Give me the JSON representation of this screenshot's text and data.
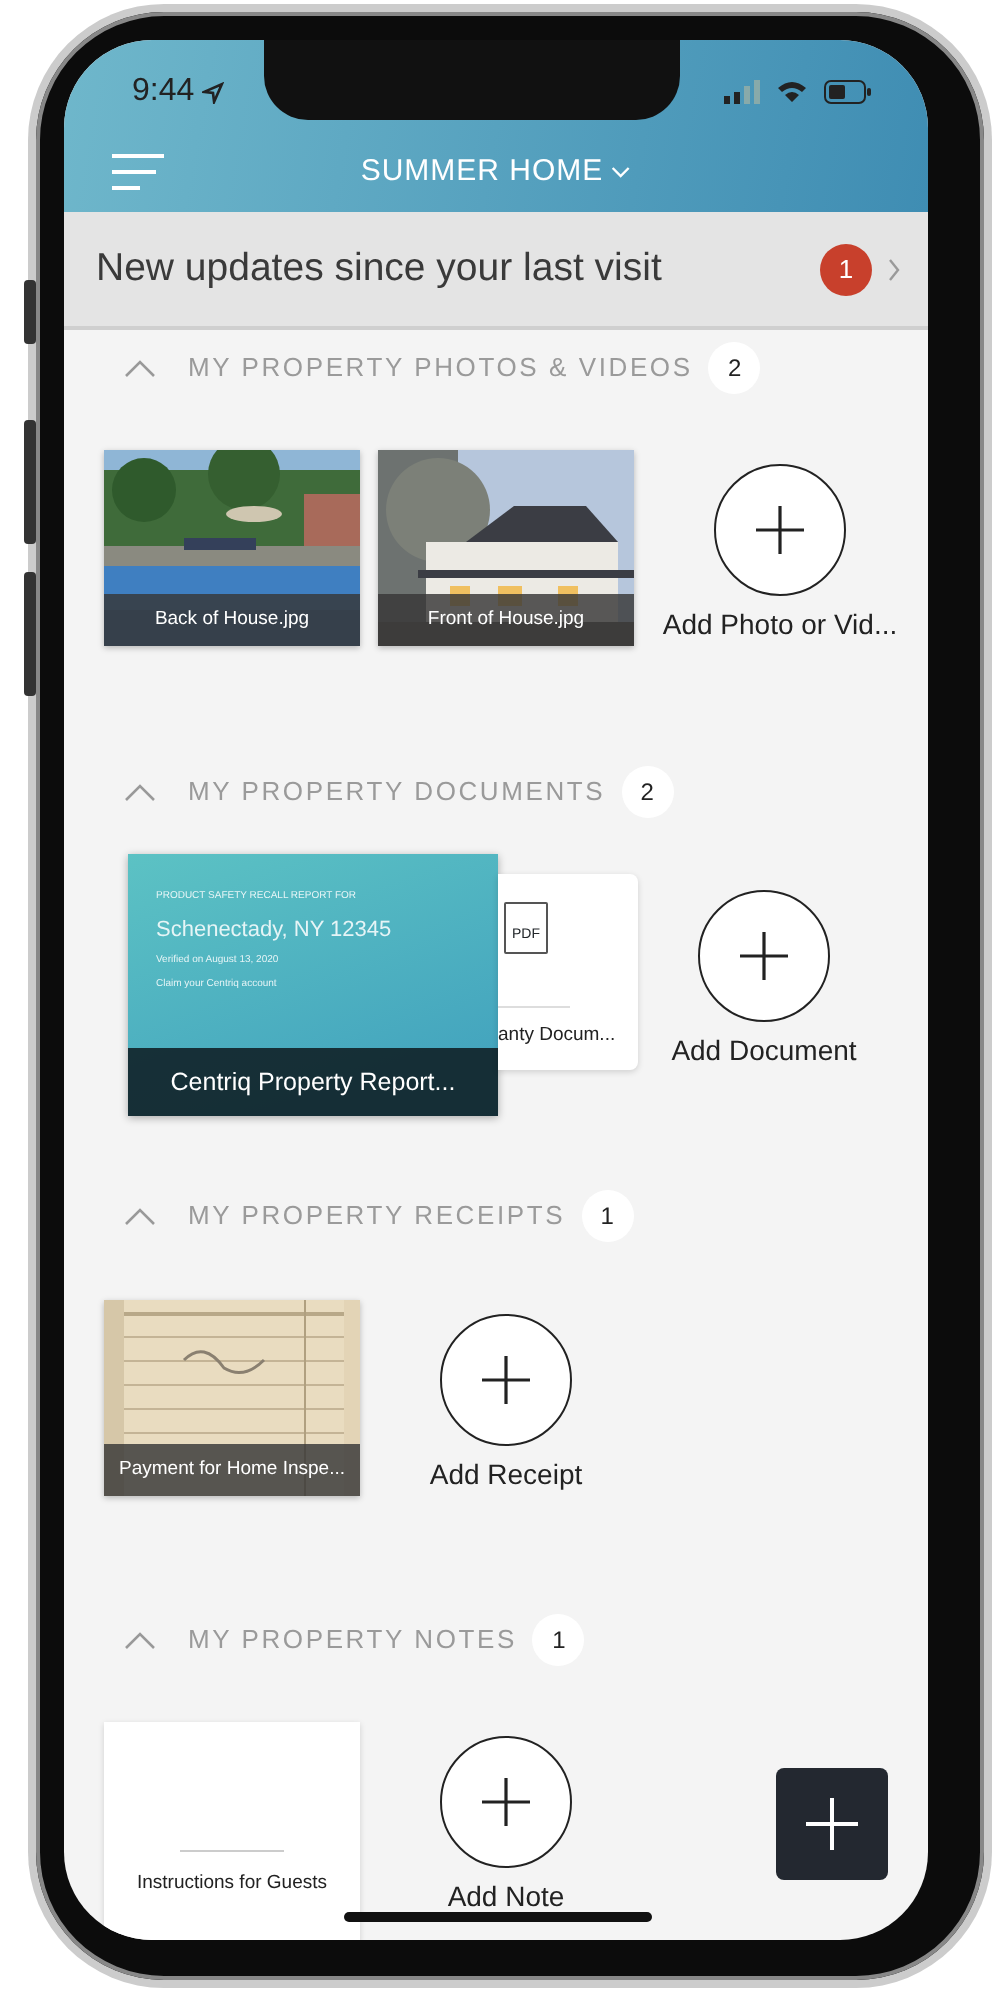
{
  "status_bar": {
    "time": "9:44"
  },
  "header": {
    "title": "SUMMER HOME"
  },
  "updates_banner": {
    "text": "New updates since your last visit",
    "count": "1"
  },
  "sections": [
    {
      "title": "MY PROPERTY PHOTOS & VIDEOS",
      "count": "2",
      "expanded": true,
      "items": [
        {
          "caption": "Back of House.jpg"
        },
        {
          "caption": "Front of House.jpg"
        }
      ],
      "add_label": "Add Photo or Vid..."
    },
    {
      "title": "MY PROPERTY DOCUMENTS",
      "count": "2",
      "expanded": true,
      "items": [
        {
          "kind": "report",
          "caption": "Centriq Property Report...",
          "lines": [
            "PRODUCT SAFETY RECALL REPORT FOR",
            "Schenectady, NY 12345",
            "Verified on August 13, 2020",
            "Claim your Centriq account"
          ]
        },
        {
          "kind": "pdf",
          "caption": "anty Docum...",
          "icon_label": "PDF"
        }
      ],
      "add_label": "Add Document"
    },
    {
      "title": "MY PROPERTY RECEIPTS",
      "count": "1",
      "expanded": true,
      "items": [
        {
          "caption": "Payment for Home Inspe..."
        }
      ],
      "add_label": "Add Receipt"
    },
    {
      "title": "MY PROPERTY NOTES",
      "count": "1",
      "expanded": true,
      "items": [
        {
          "kind": "note",
          "caption": "Instructions for Guests"
        }
      ],
      "add_label": "Add Note"
    }
  ]
}
